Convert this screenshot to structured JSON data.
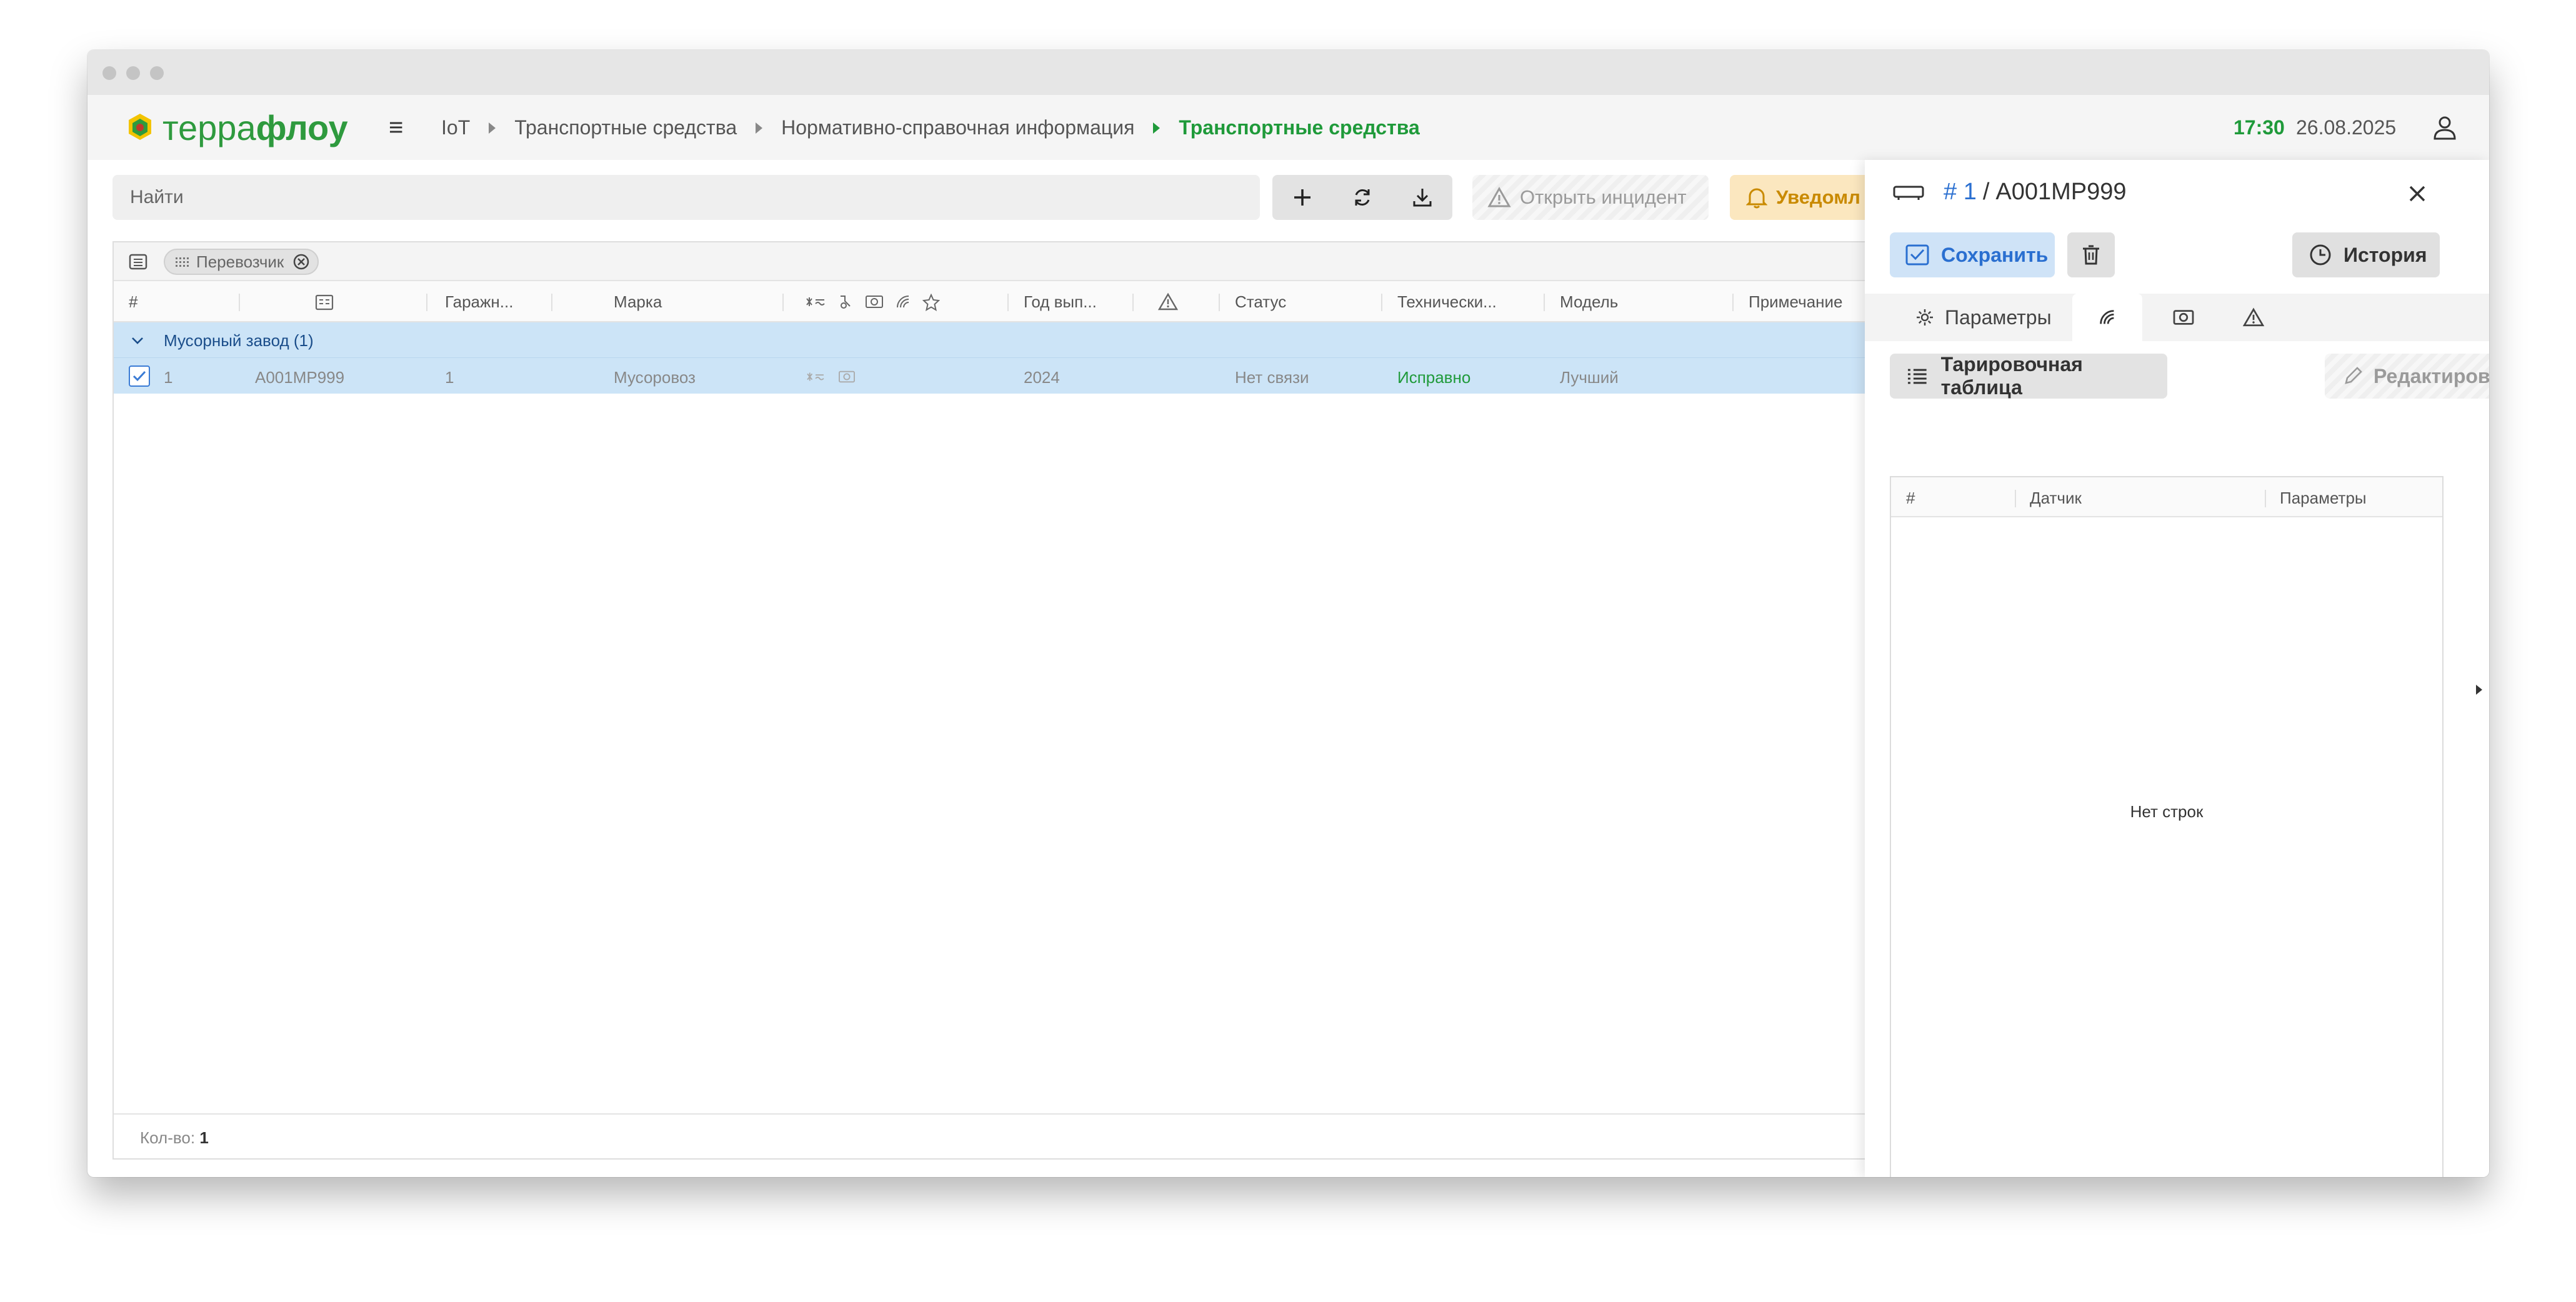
{
  "topbar": {
    "logo_part1": "терра",
    "logo_part2": "флоу",
    "breadcrumbs": [
      "IoT",
      "Транспортные средства",
      "Нормативно-справочная информация",
      "Транспортные средства"
    ],
    "time": "17:30",
    "date": "26.08.2025"
  },
  "toolbar": {
    "search_placeholder": "Найти",
    "open_incident_label": "Открыть инцидент",
    "notifications_label": "Уведомл"
  },
  "table": {
    "group_chip_label": "Перевозчик",
    "columns": [
      "#",
      "Гаражн...",
      "Марка",
      "Год вып...",
      "Статус",
      "Технически...",
      "Модель",
      "Примечание"
    ],
    "group_row": {
      "label": "Мусорный завод (1)"
    },
    "rows": [
      {
        "index": "1",
        "plate": "А001МР999",
        "garage": "1",
        "brand": "Мусоровоз",
        "year": "2024",
        "status": "Нет связи",
        "tech_state": "Исправно",
        "model": "Лучший",
        "note": ""
      }
    ],
    "footer_count_label": "Кол-во:",
    "footer_count_value": "1"
  },
  "panel": {
    "title_number": "# 1",
    "title_slash": "/",
    "title_plate": "А001МР999",
    "save_label": "Сохранить",
    "history_label": "История",
    "tabs": [
      {
        "label": "Параметры"
      }
    ],
    "calibration_button_label": "Тарировочная таблица",
    "edit_button_label": "Редактировать",
    "sensor_table": {
      "columns": [
        "#",
        "Датчик",
        "Параметры"
      ],
      "empty_text": "Нет строк"
    }
  },
  "colors": {
    "brand_green": "#2e9a3e",
    "accent_blue": "#2a6fd0",
    "selection_blue": "#cce4f7",
    "notify_amber": "#c98a00"
  }
}
